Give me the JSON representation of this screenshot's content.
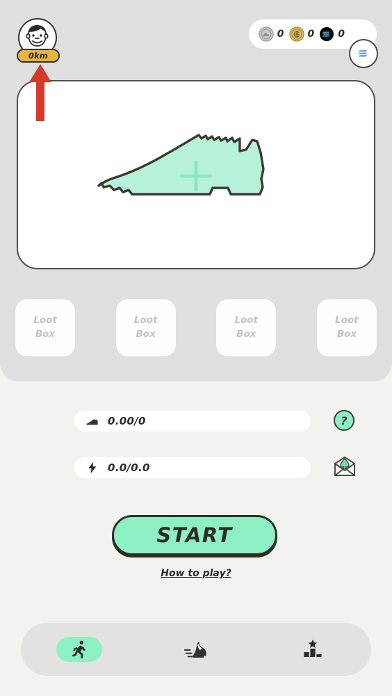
{
  "app": {
    "background_color": "#f2f2ee",
    "panel_color": "#dfdfdf",
    "accent_color": "#8df0c3",
    "outline_color": "#2d2d29",
    "badge_color": "#e7b53f"
  },
  "header": {
    "avatar": {
      "icon": "avatar-face-icon",
      "alt": "player avatar"
    },
    "distance_badge": {
      "label": "0km"
    },
    "currencies": [
      {
        "id": "shoe-token",
        "icon": "shoe-coin-icon",
        "value": "0",
        "color": "#b9b9b9"
      },
      {
        "id": "gold-token",
        "icon": "gold-coin-icon",
        "value": "0",
        "color": "#d4b25c"
      },
      {
        "id": "solana-token",
        "icon": "solana-coin-icon",
        "value": "0",
        "color": "#0a0a0a"
      }
    ],
    "wallet_button": {
      "icon": "solana-logo-icon",
      "label": ""
    }
  },
  "shoe_card": {
    "empty_slot_icon": "sneaker-outline-icon",
    "add_icon": "plus-icon",
    "shoe_fill_color": "#b6f2d8",
    "shoe_outline_color": "#3a3a36",
    "plus_color": "#8ae8bd"
  },
  "loot_boxes": [
    {
      "line1": "Loot",
      "line2": "Box"
    },
    {
      "line1": "Loot",
      "line2": "Box"
    },
    {
      "line1": "Loot",
      "line2": "Box"
    },
    {
      "line1": "Loot",
      "line2": "Box"
    }
  ],
  "stats": [
    {
      "id": "durability",
      "icon": "sneaker-icon",
      "value": "0.00/0"
    },
    {
      "id": "energy",
      "icon": "lightning-bolt-icon",
      "value": "0.0/0.0"
    }
  ],
  "side_buttons": {
    "help": {
      "icon": "question-mark-icon",
      "label": "?"
    },
    "mail": {
      "icon": "envelope-gem-icon"
    }
  },
  "actions": {
    "start_label": "START",
    "how_to_play_label": "How to play?"
  },
  "bottom_nav": [
    {
      "id": "run",
      "icon": "running-person-icon",
      "active": true
    },
    {
      "id": "sneakers",
      "icon": "sneaker-motion-icon",
      "active": false
    },
    {
      "id": "leaderboard",
      "icon": "podium-star-icon",
      "active": false
    }
  ],
  "annotation": {
    "arrow": {
      "icon": "up-arrow-annotation-icon",
      "color": "#d8392b",
      "points_to": "0km"
    }
  }
}
